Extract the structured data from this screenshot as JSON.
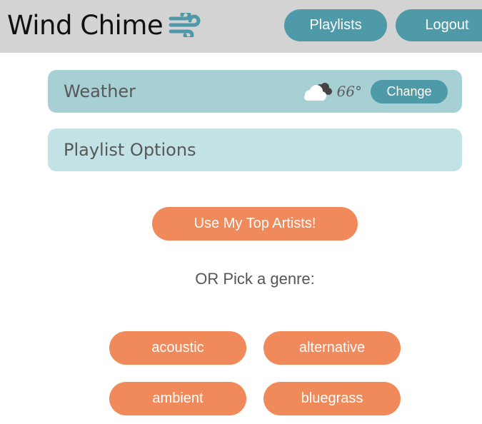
{
  "app": {
    "title": "Wind Chime",
    "logo_icon": "wind-icon",
    "accent_color": "#4f9aa9",
    "action_color": "#f08a5b"
  },
  "nav": {
    "playlists_label": "Playlists",
    "logout_label": "Logout"
  },
  "weather": {
    "title": "Weather",
    "icon": "partly-cloudy-icon",
    "temperature": "66°",
    "change_label": "Change"
  },
  "playlist_options": {
    "title": "Playlist Options"
  },
  "actions": {
    "top_artists_label": "Use My Top Artists!",
    "or_text": "OR Pick a genre:"
  },
  "genres": [
    "acoustic",
    "alternative",
    "ambient",
    "bluegrass"
  ]
}
